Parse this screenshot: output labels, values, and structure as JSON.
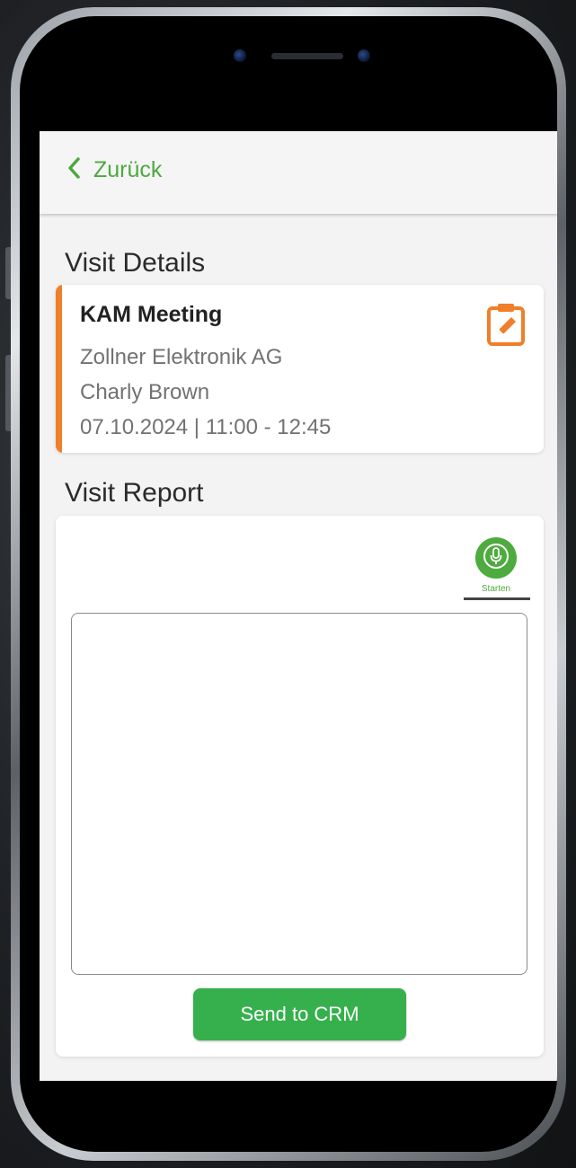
{
  "nav": {
    "back_label": "Zurück"
  },
  "visit_details": {
    "heading": "Visit Details",
    "title": "KAM Meeting",
    "company": "Zollner Elektronik AG",
    "contact": "Charly Brown",
    "datetime": "07.10.2024 | 11:00 - 12:45"
  },
  "visit_report": {
    "heading": "Visit Report",
    "mic_label": "Starten",
    "text_value": "",
    "send_label": "Send to CRM"
  },
  "icons": {
    "back": "chevron-left-icon",
    "edit": "clipboard-edit-icon",
    "mic": "microphone-icon"
  },
  "colors": {
    "accent_green": "#4ea83f",
    "button_green": "#35b04d",
    "accent_orange": "#f07f2a"
  }
}
